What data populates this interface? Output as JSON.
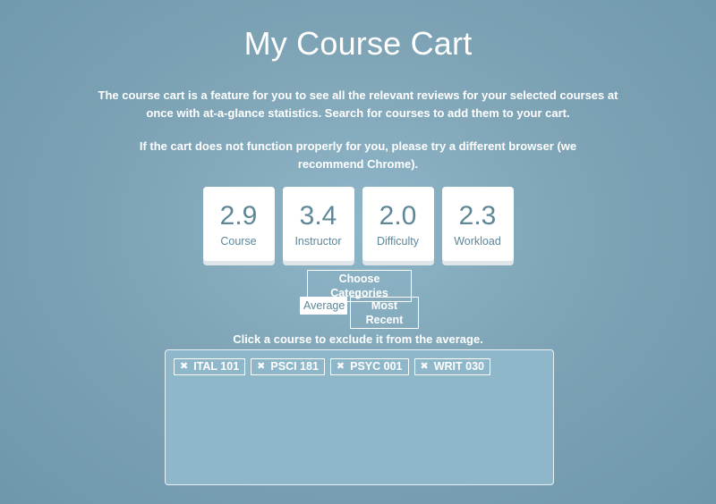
{
  "page": {
    "title": "My Course Cart",
    "description": "The course cart is a feature for you to see all the relevant reviews for your selected courses at once with at-a-glance statistics. Search for courses to add them to your cart.",
    "browser_note": "If the cart does not function properly for you, please try a different browser (we recommend Chrome)."
  },
  "stats": [
    {
      "value": "2.9",
      "label": "Course"
    },
    {
      "value": "3.4",
      "label": "Instructor"
    },
    {
      "value": "2.0",
      "label": "Difficulty"
    },
    {
      "value": "2.3",
      "label": "Workload"
    }
  ],
  "controls": {
    "choose_categories": "Choose Categories",
    "average": "Average",
    "most_recent": "Most Recent",
    "active_mode": "Average"
  },
  "cart": {
    "hint": "Click a course to exclude it from the average.",
    "remove_icon": "✖",
    "courses": [
      "ITAL 101",
      "PSCI 181",
      "PSYC 001",
      "WRIT 030"
    ]
  },
  "colors": {
    "background": "#7ea4b6",
    "card_text": "#5e8798",
    "cart_bg": "#8fb7ca"
  }
}
